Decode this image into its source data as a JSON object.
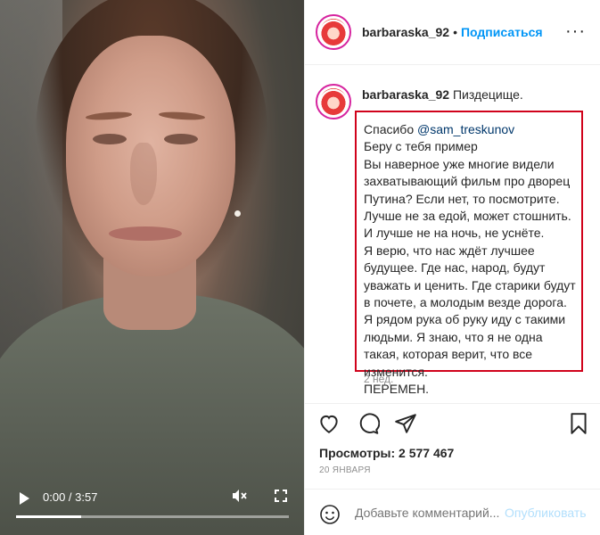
{
  "video": {
    "time": "0:00 / 3:57",
    "progress": 0.24,
    "play_icon": "play-icon",
    "mute_icon": "muted-speaker-icon",
    "fullscreen_icon": "fullscreen-icon"
  },
  "header": {
    "username": "barbaraska_92",
    "separator": "•",
    "follow_label": "Подписаться",
    "more_label": "···"
  },
  "caption": {
    "username": "barbaraska_92",
    "first_line": "Пиздецище.",
    "lines": [
      "Спасибо",
      "Беру с тебя пример",
      "Вы наверное уже многие видели захватывающий фильм про дворец Путина? Если нет, то посмотрите. Лучше не за едой, может стошнить. И лучше не на ночь, не уснёте.",
      "Я верю, что нас ждёт лучшее будущее. Где нас, народ, будут уважать и ценить. Где старики будут в почете, а молодым везде дорога. Я рядом рука об руку иду с такими людьми. Я знаю, что я не одна такая, которая верит, что все изменится.",
      "ПЕРЕМЕН."
    ],
    "mention": "@sam_treskunov",
    "ago": "2 нед.",
    "highlight_color": "#d0021b"
  },
  "stats": {
    "views": "Просмотры: 2 577 467",
    "date": "20 ЯНВАРЯ"
  },
  "comment_bar": {
    "placeholder": "Добавьте комментарий...",
    "publish_label": "Опубликовать"
  },
  "colors": {
    "link": "#0095f6",
    "muted": "#8e8e8e",
    "text": "#262626"
  }
}
